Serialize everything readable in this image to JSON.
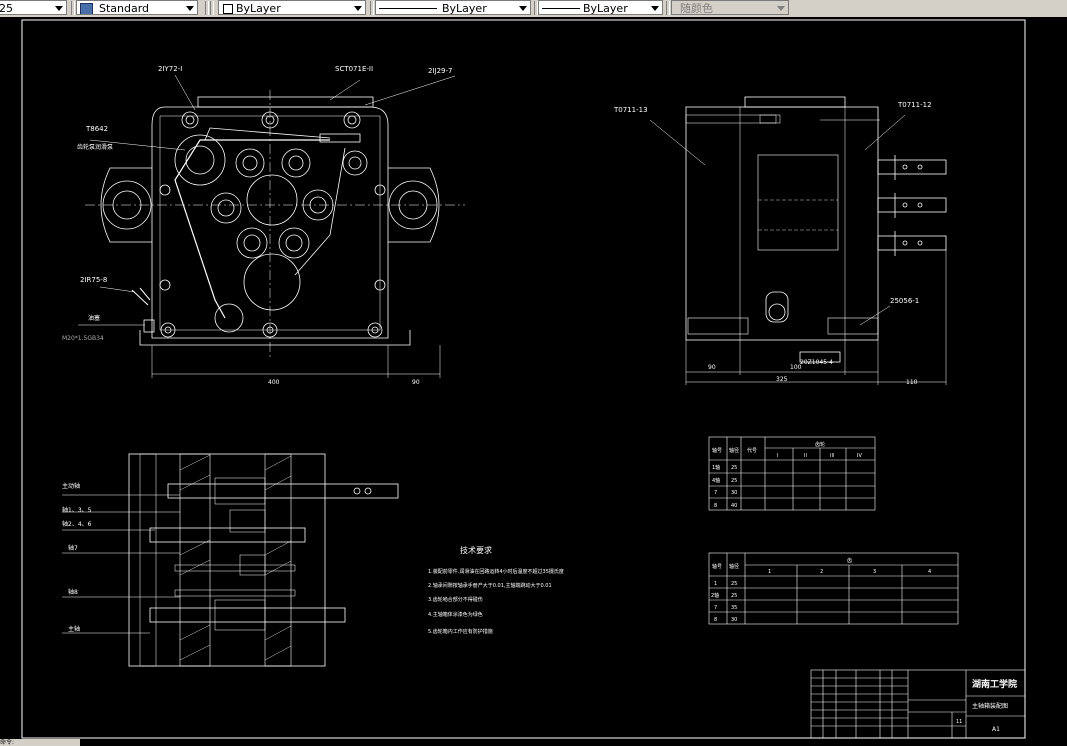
{
  "toolbar": {
    "layer_value": "25",
    "textstyle_value": "Standard",
    "color_value": "ByLayer",
    "linetype_value": "ByLayer",
    "lineweight_value": "ByLayer",
    "plotstyle_value": "随颜色"
  },
  "front_view": {
    "part_2iy72": "2IY72-I",
    "part_sct071e": "SCT071E-II",
    "part_2ij29": "2IJ29-7",
    "part_t8642": "T8642",
    "part_gear_pump": "齿轮泵润滑泵",
    "part_2ir75": "2IR75-8",
    "oil_plug": "油塞",
    "oil_plug_spec": "M20*1.5GB34",
    "dim_400": "400",
    "dim_90": "90"
  },
  "side_view": {
    "part_t0711_13": "T0711-13",
    "part_t0711_12": "T0711-12",
    "part_25056": "25056-1",
    "part_20z1045": "20Z1045-4",
    "dim_90": "90",
    "dim_100": "100",
    "dim_325": "325",
    "dim_110": "110"
  },
  "section_view": {
    "label_drive_shaft": "主动轴",
    "label_shaft_135": "轴1、3、5",
    "label_shaft_246": "轴2、4、6",
    "label_shaft_7": "轴7",
    "label_shaft_8": "轴8",
    "label_spindle": "主轴"
  },
  "tech_req": {
    "title": "技术要求",
    "lines": [
      "1.装配前零件.润滑油在回路运转4小时后温度不超过35摄氏度",
      "2.轴承间隙按轴承手册产大于0.01,主轴端跳动大于0.01",
      "3.齿轮啮合部分不得碰伤",
      "4.主轴箱体涂漆色为绿色",
      "5.齿轮箱内工作应有防护措施"
    ]
  },
  "table1": {
    "headers": [
      "轴号",
      "轴径",
      "代号",
      "齿轮"
    ],
    "sub_headers": [
      "I",
      "II",
      "III",
      "IV"
    ],
    "rows": [
      {
        "shaft": "1轴",
        "dia": "25"
      },
      {
        "shaft": "4轴",
        "dia": "25"
      },
      {
        "shaft": "7",
        "dia": "30"
      },
      {
        "shaft": "8",
        "dia": "40"
      }
    ]
  },
  "table2": {
    "headers": [
      "轴号",
      "轴径",
      "齿"
    ],
    "sub_headers": [
      "1",
      "2",
      "3",
      "4"
    ],
    "rows": [
      {
        "shaft": "1",
        "dia": "25"
      },
      {
        "shaft": "2轴",
        "dia": "25"
      },
      {
        "shaft": "7",
        "dia": "35"
      },
      {
        "shaft": "8",
        "dia": "30"
      }
    ]
  },
  "title_block": {
    "school": "湖南工学院",
    "drawing_name": "主轴箱装配图",
    "paper": "A1",
    "sheet": "11"
  },
  "command_line": "命令:"
}
